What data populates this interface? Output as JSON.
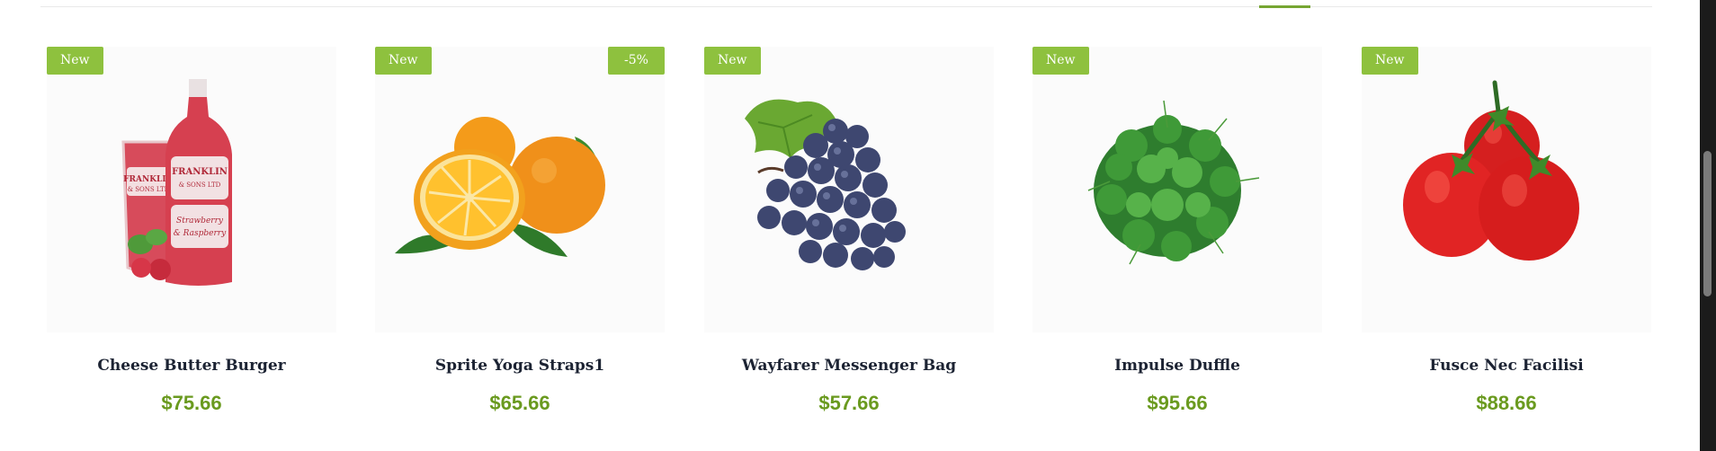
{
  "products": [
    {
      "name": "Cheese Butter Burger",
      "price": "$75.66",
      "badge": "New",
      "image": "strawberry-raspberry-bottle-and-glass"
    },
    {
      "name": "Sprite Yoga Straps1",
      "price": "$65.66",
      "badge": "New",
      "sale_badge": "-5%",
      "image": "oranges"
    },
    {
      "name": "Wayfarer Messenger Bag",
      "price": "$57.66",
      "badge": "New",
      "image": "grapes"
    },
    {
      "name": "Impulse Duffle",
      "price": "$95.66",
      "badge": "New",
      "image": "watercress-greens"
    },
    {
      "name": "Fusce Nec Facilisi",
      "price": "$88.66",
      "badge": "New",
      "image": "tomatoes"
    }
  ],
  "label_art": {
    "brand_line1": "FRANKLIN",
    "brand_line2": "& SONS LTD",
    "flavor_line1": "Strawberry",
    "flavor_line2": "& Raspberry"
  },
  "colors": {
    "badge": "#8ec13e",
    "price": "#6a9a1f",
    "title": "#1c2333",
    "tab_underline": "#76a632"
  }
}
